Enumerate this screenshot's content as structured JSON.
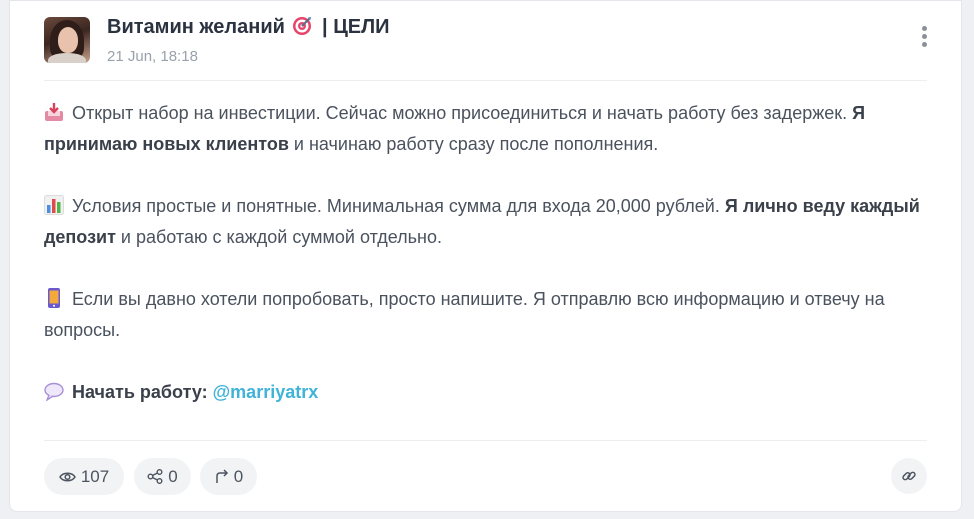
{
  "post": {
    "channel_name": "Витамин желаний",
    "channel_tag": "| ЦЕЛИ",
    "date": "21 Jun, 18:18",
    "paragraphs": [
      {
        "icon": "inbox-tray-icon",
        "text1": "Открыт набор на инвестиции. Сейчас можно присоединиться и начать работу без задержек. ",
        "bold": "Я принимаю новых клиентов",
        "text2": " и начинаю работу сразу после пополнения."
      },
      {
        "icon": "bar-chart-icon",
        "text1": "Условия простые и понятные. Минимальная сумма для входа 20,000 рублей. ",
        "bold": "Я лично веду каждый депозит",
        "text2": " и работаю с каждой суммой отдельно."
      },
      {
        "icon": "mobile-phone-icon",
        "text1": "Если вы давно хотели попробовать, просто напишите. Я отправлю всю информацию и отвечу на вопросы."
      },
      {
        "icon": "speech-bubble-icon",
        "bold": "Начать работу:",
        "link": "@marriyatrx"
      }
    ]
  },
  "stats": {
    "views": "107",
    "shares": "0",
    "forwards": "0"
  },
  "colors": {
    "link": "#3fb3d8",
    "text": "#4a525e",
    "title": "#2b3340",
    "muted": "#9aa1ab"
  }
}
